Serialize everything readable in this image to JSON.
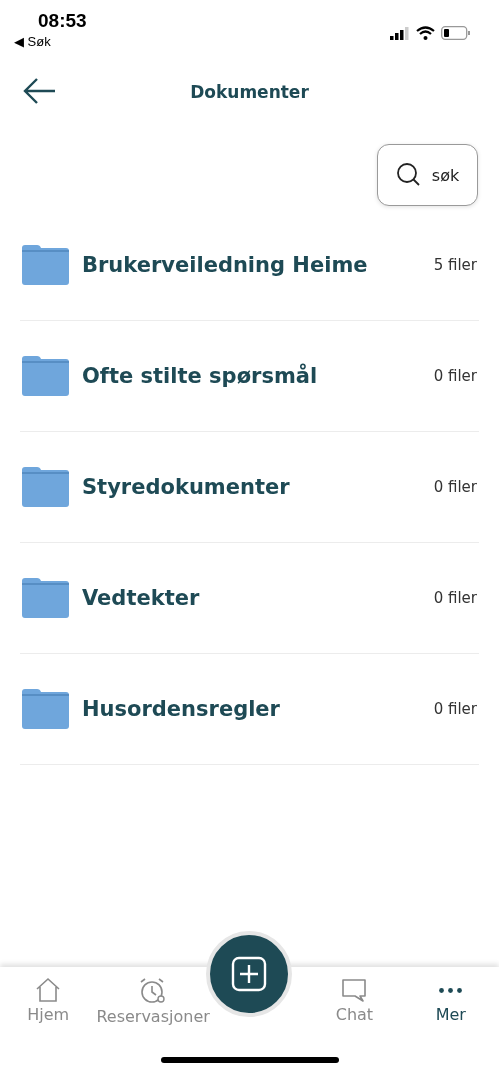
{
  "status_bar": {
    "time": "08:53",
    "back_link": "◀ Søk"
  },
  "header": {
    "title": "Dokumenter"
  },
  "search": {
    "label": "søk"
  },
  "folders": [
    {
      "name": "Brukerveiledning Heime",
      "count": "5 filer"
    },
    {
      "name": "Ofte stilte spørsmål",
      "count": "0 filer"
    },
    {
      "name": "Styredokumenter",
      "count": "0 filer"
    },
    {
      "name": "Vedtekter",
      "count": "0 filer"
    },
    {
      "name": "Husordensregler",
      "count": "0 filer"
    }
  ],
  "tab_bar": [
    {
      "label": "Hjem",
      "selected": false
    },
    {
      "label": "Reservasjoner",
      "selected": false
    },
    {
      "label": "Chat",
      "selected": false
    },
    {
      "label": "Mer",
      "selected": true
    }
  ]
}
